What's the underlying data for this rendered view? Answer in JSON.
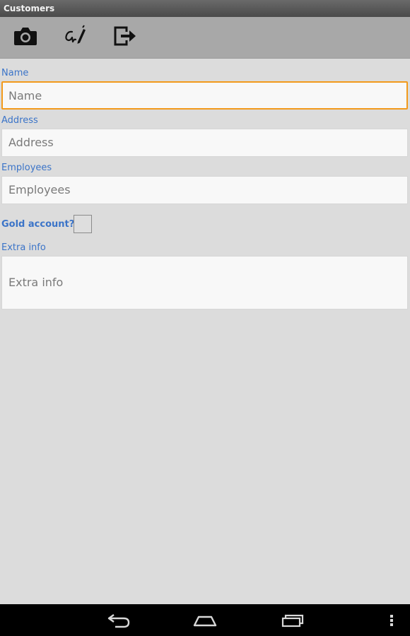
{
  "app": {
    "title": "Customers"
  },
  "toolbar": {
    "icons": [
      "camera-icon",
      "signature-icon",
      "exit-icon"
    ]
  },
  "form": {
    "name": {
      "label": "Name",
      "placeholder": "Name"
    },
    "address": {
      "label": "Address",
      "placeholder": "Address"
    },
    "employees": {
      "label": "Employees",
      "placeholder": "Employees"
    },
    "gold_account": {
      "label": "Gold account?",
      "checked": false
    },
    "extra_info": {
      "label": "Extra info",
      "placeholder": "Extra info"
    }
  },
  "nav": {
    "icons": [
      "back-icon",
      "home-icon",
      "recent-apps-icon",
      "menu-icon"
    ]
  },
  "colors": {
    "label": "#3b74c8",
    "focus_border": "#f29a1b",
    "toolbar": "#a8a8a8",
    "background": "#dcdcdc"
  }
}
